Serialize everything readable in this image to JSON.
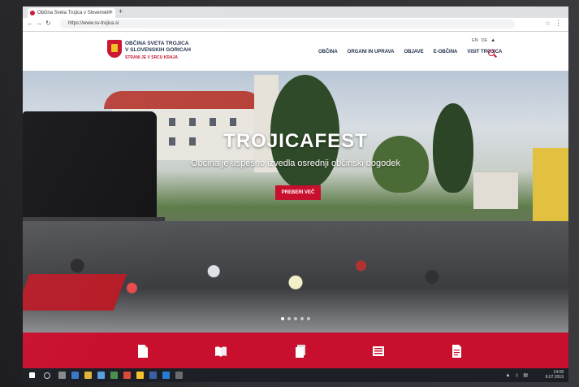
{
  "browser": {
    "tab_title": "Občina Sveta Trojica v Slovenskih",
    "tab_close": "×",
    "new_tab": "+",
    "url": "https://www.sv-trojica.si"
  },
  "site": {
    "logo_line1": "OBČINA SVETA TROJICA",
    "logo_line2": "V SLOVENSKIH GORICAH",
    "logo_tagline": "STRANI JE V SRCU KRAJA"
  },
  "nav": {
    "items": [
      "OBČINA",
      "ORGANI IN UPRAVA",
      "OBJAVE",
      "E-OBČINA",
      "VISIT TROJICA"
    ]
  },
  "lang": {
    "en": "EN",
    "de": "DE"
  },
  "hero": {
    "title": "TROJICAFEST",
    "subtitle": "Občina je uspešno izvedla osrednji občinski dogodek",
    "button": "PREBERI VEČ"
  },
  "quickbar": {
    "icons": [
      "document-icon",
      "open-book-icon",
      "files-icon",
      "newspaper-icon",
      "form-icon"
    ]
  },
  "taskbar": {
    "time": "14:08",
    "date": "8.07.2019"
  },
  "colors": {
    "brand_red": "#c8102e",
    "brand_navy": "#1e2d4a"
  }
}
